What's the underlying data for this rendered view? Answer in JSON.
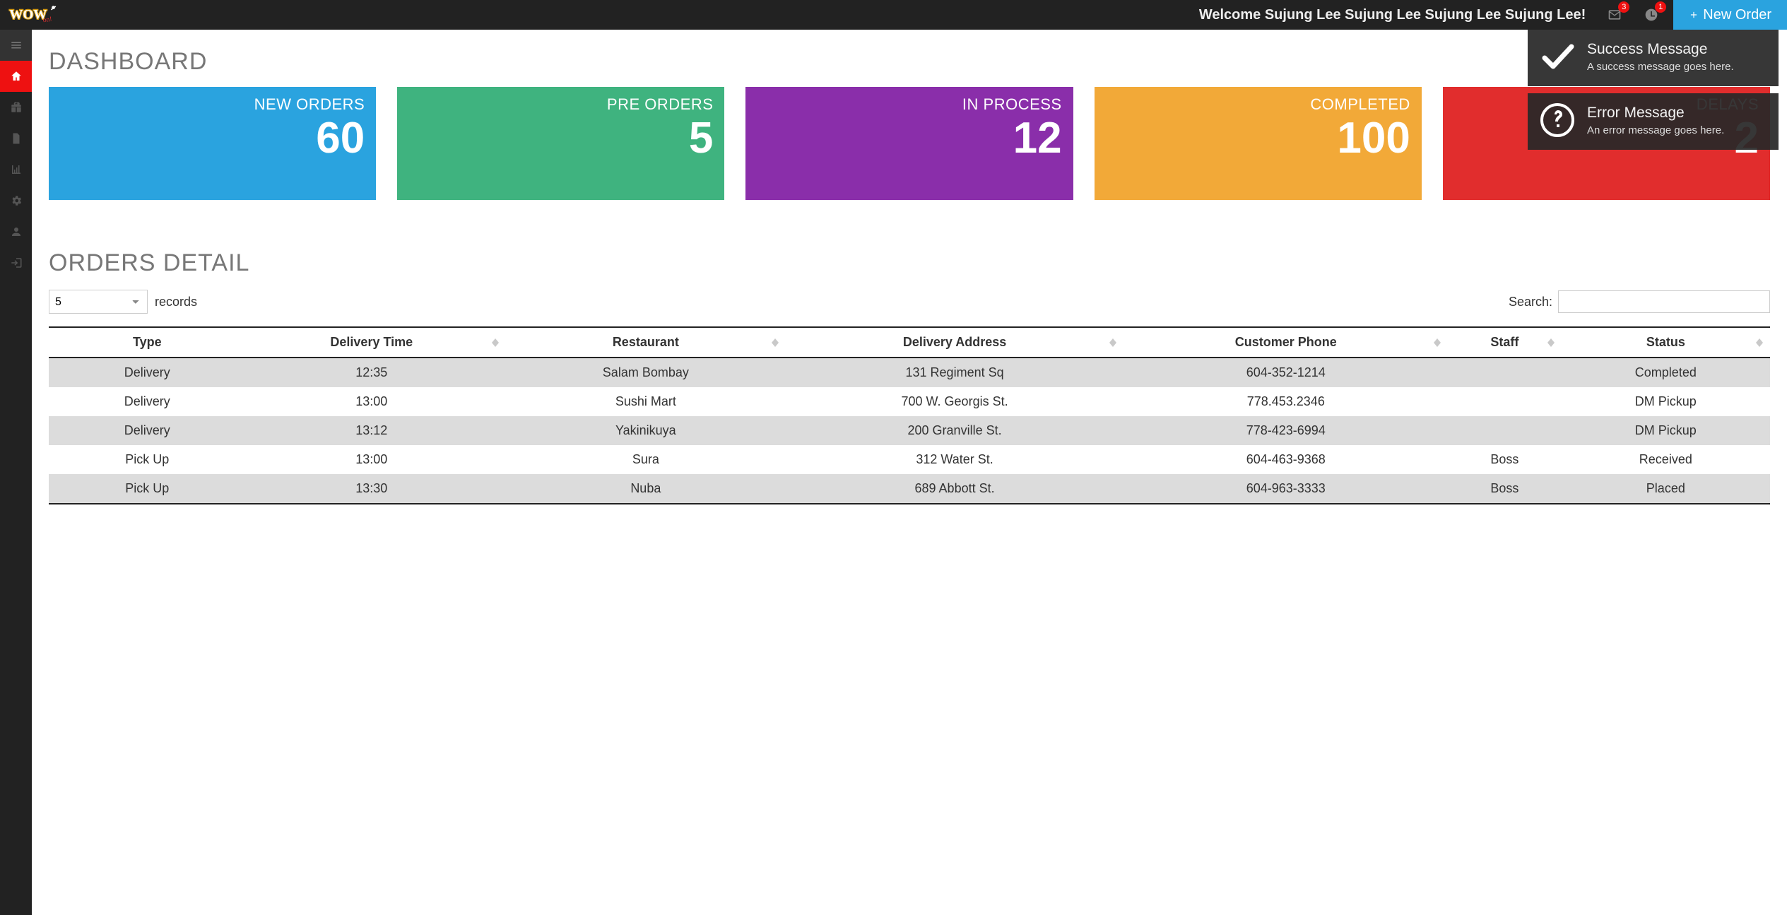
{
  "header": {
    "welcome_text": "Welcome Sujung Lee Sujung Lee Sujung Lee Sujung Lee!",
    "new_order_label": "New Order",
    "notif_badge_1": "3",
    "notif_badge_2": "1"
  },
  "sidebar": {
    "items": [
      {
        "name": "menu-icon"
      },
      {
        "name": "home-icon",
        "active": true
      },
      {
        "name": "gift-icon"
      },
      {
        "name": "file-icon"
      },
      {
        "name": "chart-icon"
      },
      {
        "name": "gears-icon"
      },
      {
        "name": "user-icon"
      },
      {
        "name": "signout-icon"
      }
    ]
  },
  "dashboard": {
    "title": "DASHBOARD",
    "cards": [
      {
        "label": "NEW ORDERS",
        "value": "60",
        "color": "blue"
      },
      {
        "label": "PRE ORDERS",
        "value": "5",
        "color": "green"
      },
      {
        "label": "IN PROCESS",
        "value": "12",
        "color": "purple"
      },
      {
        "label": "COMPLETED",
        "value": "100",
        "color": "orange"
      },
      {
        "label": "DELAYS",
        "value": "2",
        "color": "red"
      }
    ]
  },
  "orders": {
    "section_title": "ORDERS DETAIL",
    "records_value": "5",
    "records_label": "records",
    "search_label": "Search:",
    "search_value": "",
    "columns": [
      "Type",
      "Delivery Time",
      "Restaurant",
      "Delivery Address",
      "Customer Phone",
      "Staff",
      "Status"
    ],
    "sortable": [
      false,
      true,
      true,
      true,
      true,
      true,
      true
    ],
    "rows": [
      {
        "type": "Delivery",
        "time": "12:35",
        "restaurant": "Salam Bombay",
        "address": "131 Regiment Sq",
        "phone": "604-352-1214",
        "staff": "",
        "status": "Completed"
      },
      {
        "type": "Delivery",
        "time": "13:00",
        "restaurant": "Sushi Mart",
        "address": "700 W. Georgis St.",
        "phone": "778.453.2346",
        "staff": "",
        "status": "DM Pickup"
      },
      {
        "type": "Delivery",
        "time": "13:12",
        "restaurant": "Yakinikuya",
        "address": "200 Granville St.",
        "phone": "778-423-6994",
        "staff": "",
        "status": "DM Pickup"
      },
      {
        "type": "Pick Up",
        "time": "13:00",
        "restaurant": "Sura",
        "address": "312 Water St.",
        "phone": "604-463-9368",
        "staff": "Boss",
        "status": "Received"
      },
      {
        "type": "Pick Up",
        "time": "13:30",
        "restaurant": "Nuba",
        "address": "689 Abbott St.",
        "phone": "604-963-3333",
        "staff": "Boss",
        "status": "Placed"
      }
    ]
  },
  "toasts": [
    {
      "kind": "success",
      "title": "Success Message",
      "text": "A success message goes here."
    },
    {
      "kind": "error",
      "title": "Error Message",
      "text": "An error message goes here."
    }
  ]
}
